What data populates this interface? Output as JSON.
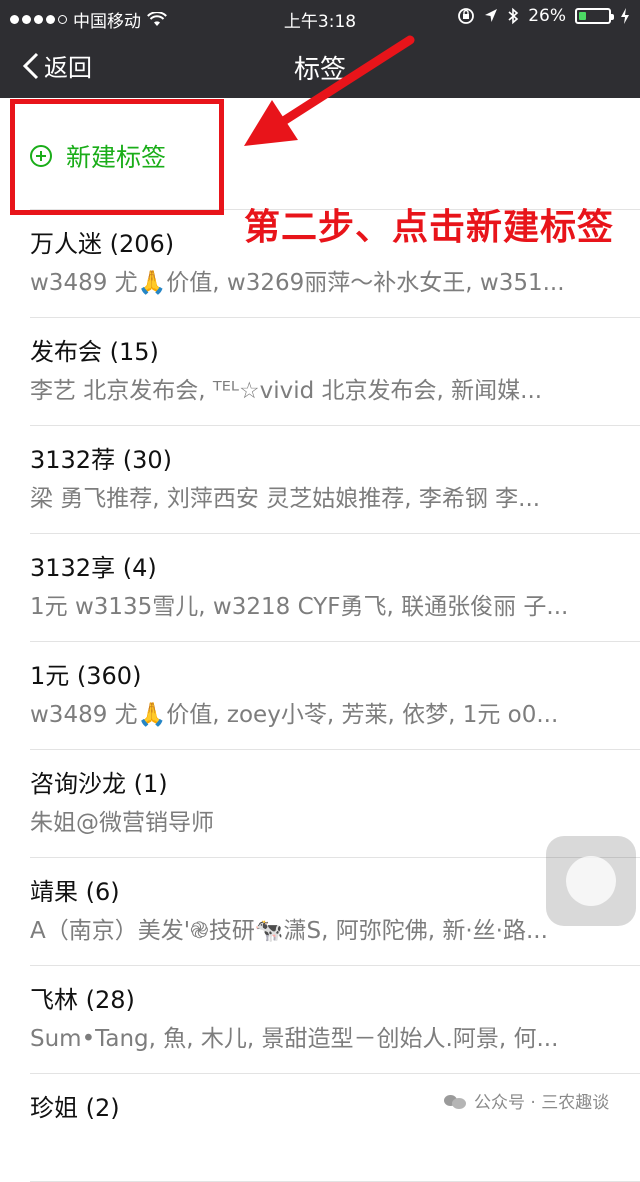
{
  "status_bar": {
    "carrier": "中国移动",
    "time": "上午3:18",
    "battery_percent": "26%",
    "battery_level": 0.26,
    "battery_color": "#4cd964"
  },
  "nav": {
    "back_label": "返回",
    "title": "标签"
  },
  "new_tag": {
    "label": "新建标签",
    "color": "#1aad19"
  },
  "annotation": {
    "text": "第二步、点击新建标签",
    "color": "#e8141a"
  },
  "tags": [
    {
      "name": "万人迷 (206)",
      "members": "w3489 尤🙏价值, w3269丽萍～补水女王, w351..."
    },
    {
      "name": "发布会 (15)",
      "members": "李艺 北京发布会, ᵀᴱᴸ☆vivid 北京发布会, 新闻媒..."
    },
    {
      "name": "3132荐 (30)",
      "members": "梁 勇飞推荐, 刘萍西安 灵芝姑娘推荐, 李希钢 李..."
    },
    {
      "name": "3132享 (4)",
      "members": "1元 w3135雪儿, w3218 CYF勇飞, 联通张俊丽  子..."
    },
    {
      "name": "1元 (360)",
      "members": "w3489 尤🙏价值, zoey小苓, 芳莱, 依梦, 1元 o0..."
    },
    {
      "name": "咨询沙龙 (1)",
      "members": "朱姐@微营销导师"
    },
    {
      "name": "靖果 (6)",
      "members": "A（南京）美发'֎技研🐄潇S, 阿弥陀佛, 新·丝·路..."
    },
    {
      "name": "飞林 (28)",
      "members": "Sum•Tang, 魚, 木儿, 景甜造型－创始人.阿景, 何..."
    },
    {
      "name": "珍姐 (2)",
      "members": ""
    }
  ],
  "watermark": {
    "text": "公众号 · 三农趣谈"
  }
}
